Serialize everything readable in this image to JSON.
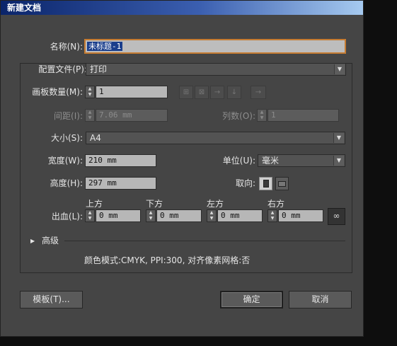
{
  "window": {
    "title": "新建文档"
  },
  "name_label": "名称(N):",
  "name_value": "未标题-1",
  "profile": {
    "label": "配置文件(P):",
    "value": "打印"
  },
  "artboards": {
    "label": "画板数量(M):",
    "value": "1"
  },
  "spacing": {
    "label": "间距(I):",
    "value": "7.06 mm"
  },
  "columns": {
    "label": "列数(O):",
    "value": "1"
  },
  "size": {
    "label": "大小(S):",
    "value": "A4"
  },
  "width": {
    "label": "宽度(W):",
    "value": "210 mm"
  },
  "units": {
    "label": "单位(U):",
    "value": "毫米"
  },
  "height": {
    "label": "高度(H):",
    "value": "297 mm"
  },
  "orientation": {
    "label": "取向:",
    "selected": "portrait"
  },
  "bleed": {
    "label": "出血(L):",
    "top": {
      "label": "上方",
      "value": "0 mm"
    },
    "bottom": {
      "label": "下方",
      "value": "0 mm"
    },
    "left": {
      "label": "左方",
      "value": "0 mm"
    },
    "right": {
      "label": "右方",
      "value": "0 mm"
    }
  },
  "advanced": {
    "label": "高级"
  },
  "summary": "颜色模式:CMYK, PPI:300, 对齐像素网格:否",
  "buttons": {
    "templates": "模板(T)...",
    "ok": "确定",
    "cancel": "取消"
  },
  "colors": {
    "titlebar_start": "#0a246a",
    "titlebar_end": "#a6caf0",
    "dialog_bg": "#454545",
    "focus_border": "#c67c32"
  },
  "icons": [
    "grid-by-row-icon",
    "grid-by-column-icon",
    "arrange-by-row-icon",
    "arrange-by-column-icon",
    "right-to-left-icon",
    "portrait-icon",
    "landscape-icon",
    "link-icon",
    "triangle-right-icon",
    "chevron-down-icon"
  ]
}
